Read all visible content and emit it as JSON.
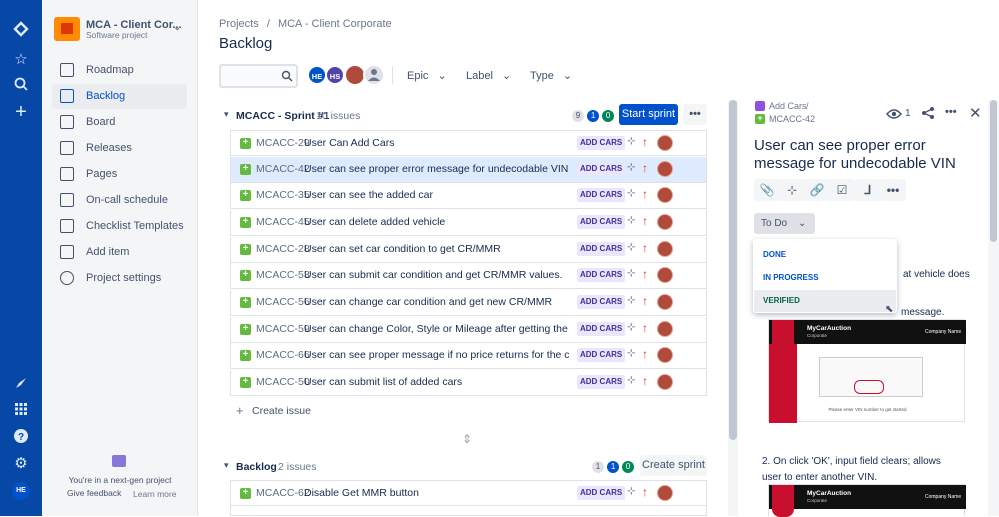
{
  "project": {
    "name": "MCA - Client Cor...",
    "type": "Software project"
  },
  "sidebar": {
    "items": [
      {
        "label": "Roadmap",
        "icon": "roadmap-icon"
      },
      {
        "label": "Backlog",
        "icon": "backlog-icon"
      },
      {
        "label": "Board",
        "icon": "board-icon"
      },
      {
        "label": "Releases",
        "icon": "releases-icon"
      },
      {
        "label": "Pages",
        "icon": "pages-icon"
      },
      {
        "label": "On-call schedule",
        "icon": "on-call-icon"
      },
      {
        "label": "Checklist Templates",
        "icon": "checklist-icon"
      },
      {
        "label": "Add item",
        "icon": "add-item-icon"
      },
      {
        "label": "Project settings",
        "icon": "settings-icon"
      }
    ],
    "footer": {
      "note": "You're in a next-gen project",
      "give_feedback": "Give feedback",
      "learn_more": "Learn more"
    }
  },
  "global_nav": {
    "user_initials": "HE"
  },
  "breadcrumb": {
    "projects": "Projects",
    "sep": "/",
    "project": "MCA - Client Corporate"
  },
  "page_title": "Backlog",
  "filters": {
    "search_placeholder": "",
    "avatars": [
      "HE",
      "HS"
    ],
    "epic": "Epic",
    "label": "Label",
    "type": "Type"
  },
  "sprint": {
    "name": "MCACC - Sprint #1",
    "count": "10 issues",
    "todo": "9",
    "inprogress": "1",
    "done": "0",
    "start_label": "Start sprint",
    "create_issue": "Create issue",
    "issues": [
      {
        "key": "MCACC-29",
        "summary": "User Can Add Cars",
        "epic": "ADD CARS"
      },
      {
        "key": "MCACC-42",
        "summary": "User can see proper error message for undecodable VIN",
        "epic": "ADD CARS"
      },
      {
        "key": "MCACC-35",
        "summary": "User can see the added car",
        "epic": "ADD CARS"
      },
      {
        "key": "MCACC-45",
        "summary": "User can delete added vehicle",
        "epic": "ADD CARS"
      },
      {
        "key": "MCACC-28",
        "summary": "User can set car condition to get CR/MMR",
        "epic": "ADD CARS"
      },
      {
        "key": "MCACC-53",
        "summary": "User can submit car condition and get CR/MMR values.",
        "epic": "ADD CARS"
      },
      {
        "key": "MCACC-56",
        "summary": "User can change car condition and get new CR/MMR",
        "epic": "ADD CARS"
      },
      {
        "key": "MCACC-59",
        "summary": "User can change Color, Style or Mileage after getting the CR/M...",
        "epic": "ADD CARS"
      },
      {
        "key": "MCACC-66",
        "summary": "User can see proper message if no price returns for the car.",
        "epic": "ADD CARS"
      },
      {
        "key": "MCACC-50",
        "summary": "User can submit list of added cars",
        "epic": "ADD CARS"
      }
    ]
  },
  "backlog": {
    "name": "Backlog",
    "count": "2 issues",
    "todo": "1",
    "inprogress": "1",
    "done": "0",
    "create_sprint": "Create sprint",
    "issues": [
      {
        "key": "MCACC-62",
        "summary": "Disable Get MMR button",
        "epic": "ADD CARS"
      }
    ]
  },
  "detail": {
    "parent": "Add Cars",
    "sep": "/",
    "key": "MCACC-42",
    "watchers": "1",
    "title": "User can see proper error message for undecodable VIN",
    "status": "To Do",
    "status_options": [
      "DONE",
      "IN PROGRESS",
      "VERIFIED"
    ],
    "body_partial_1": "at vehicle does",
    "body_partial_2": "message.",
    "step2": "2. On click 'OK', input field clears; allows user to enter another VIN.",
    "shot": {
      "brand": "MyCarAuction",
      "sub": "Corporate",
      "company": "Company Name",
      "caption": "Please enter VIN number to get started"
    }
  },
  "colors": {
    "brand": "#0052cc",
    "nav": "#0747a6",
    "epic_bg": "#eae6ff",
    "epic_fg": "#403294",
    "story": "#63ba3c",
    "priority": "#de350b"
  }
}
